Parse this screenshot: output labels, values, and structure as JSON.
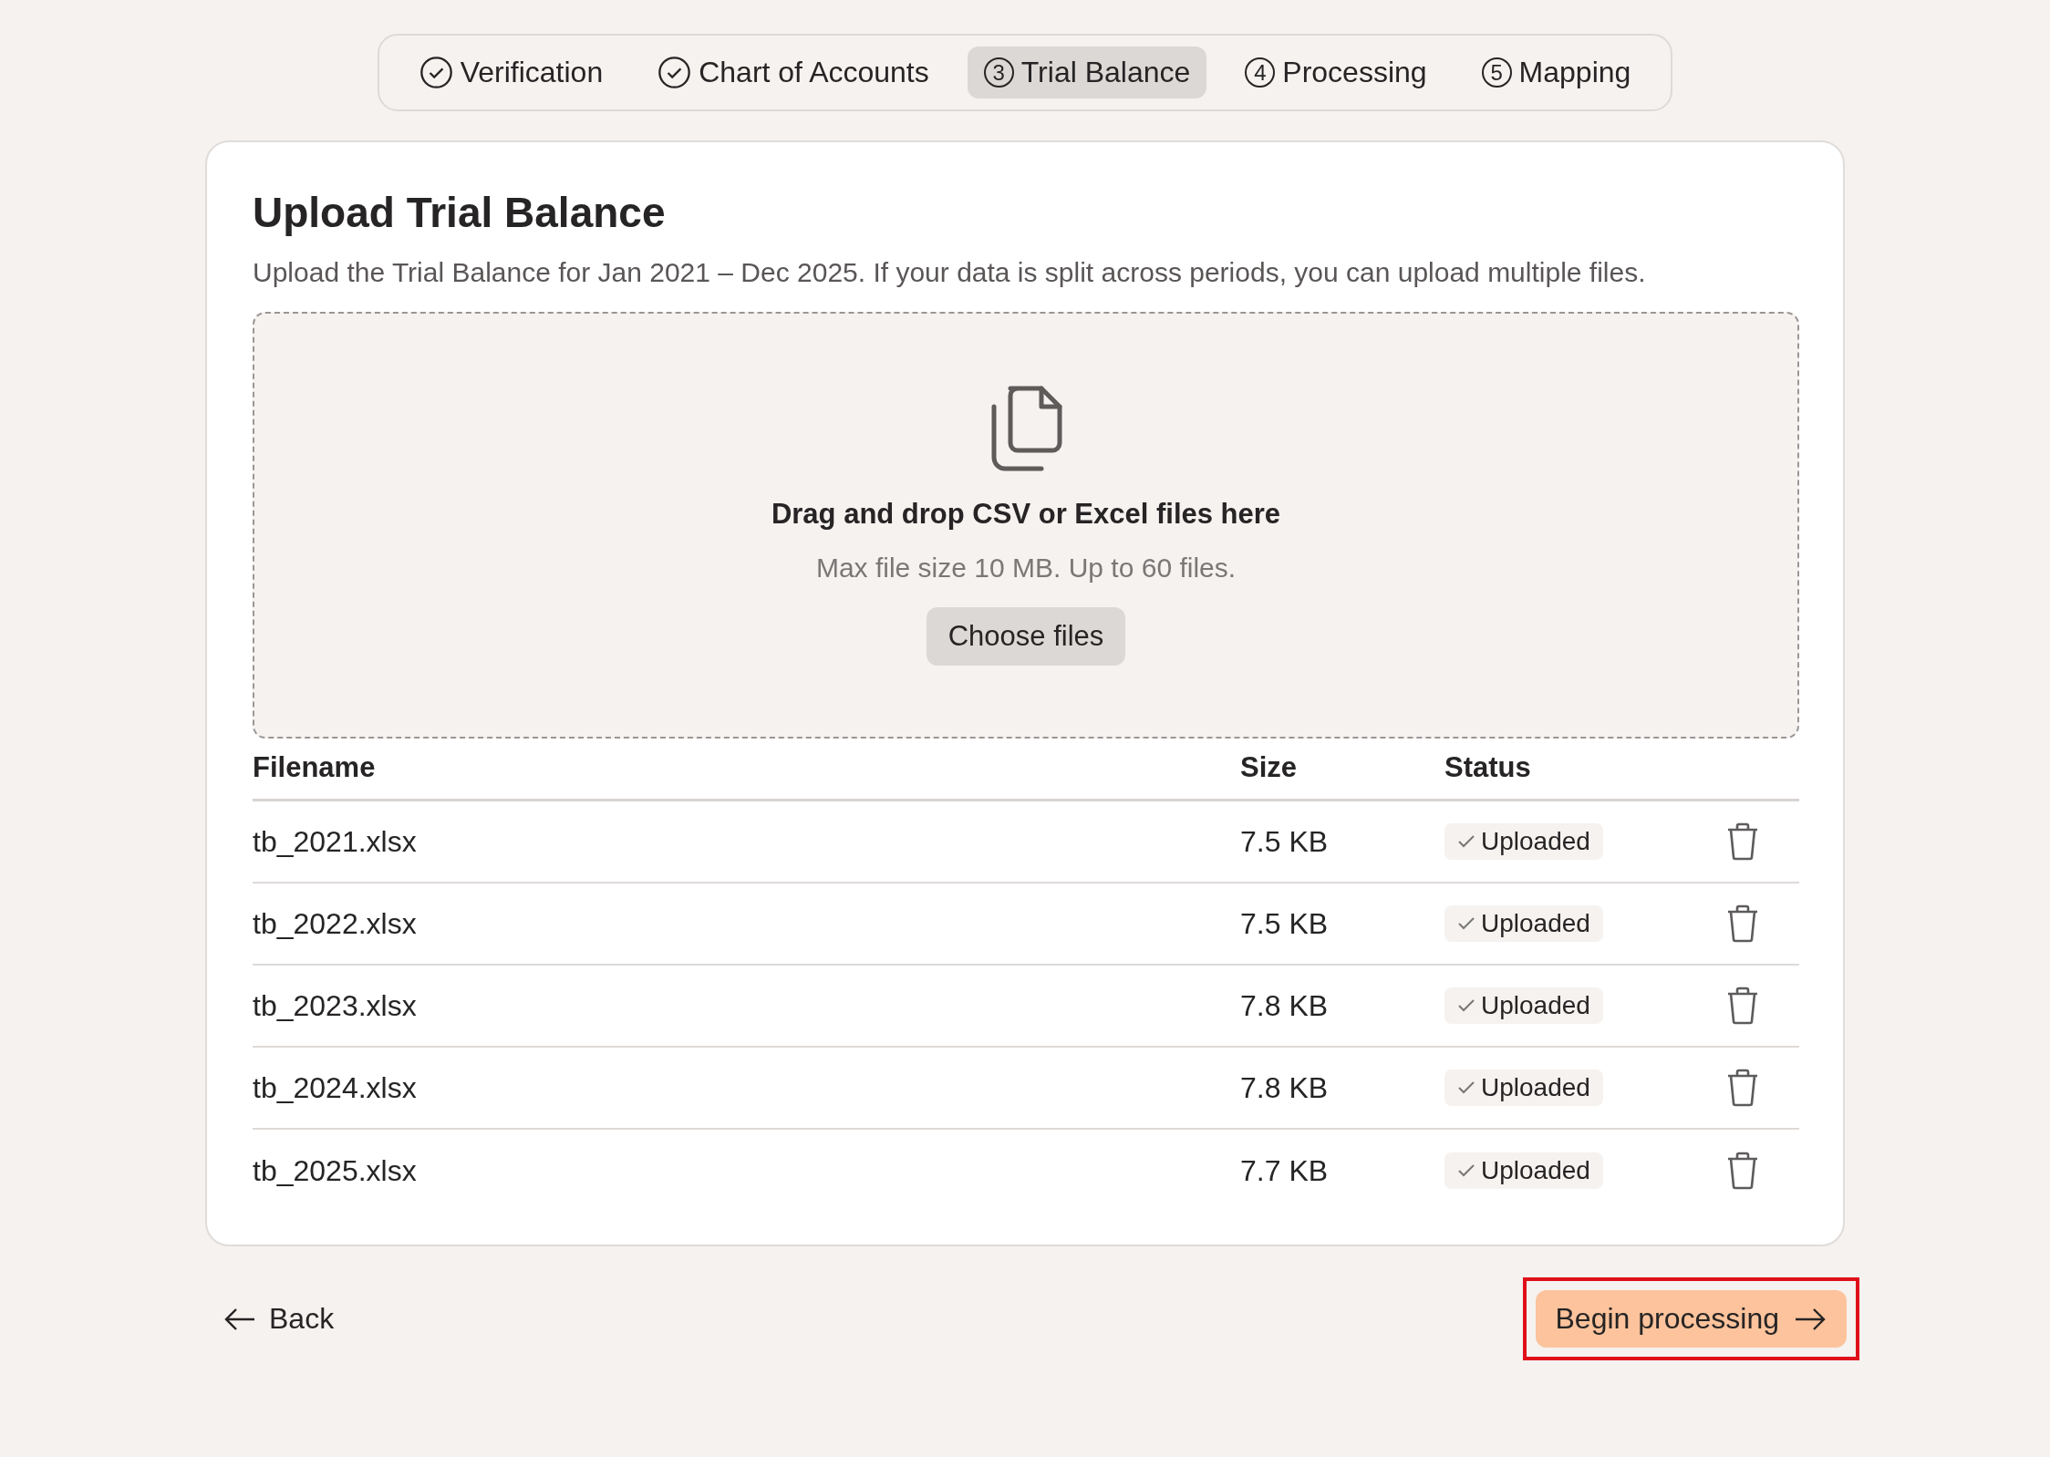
{
  "stepper": [
    {
      "label": "Verification",
      "kind": "done",
      "selected": false
    },
    {
      "label": "Chart of Accounts",
      "kind": "done",
      "selected": false
    },
    {
      "label": "Trial Balance",
      "kind": "numbered",
      "number": "3",
      "selected": true
    },
    {
      "label": "Processing",
      "kind": "numbered",
      "number": "4",
      "selected": false
    },
    {
      "label": "Mapping",
      "kind": "numbered",
      "number": "5",
      "selected": false
    }
  ],
  "card": {
    "title": "Upload Trial Balance",
    "description": "Upload the Trial Balance for Jan 2021 – Dec 2025. If your data is split across periods, you can upload multiple files.",
    "dropzone": {
      "heading": "Drag and drop CSV or Excel files here",
      "hint": "Max file size 10 MB. Up to 60 files.",
      "button": "Choose files"
    },
    "table": {
      "columns": [
        "Filename",
        "Size",
        "Status"
      ],
      "rows": [
        {
          "filename": "tb_2021.xlsx",
          "size": "7.5 KB",
          "status": "Uploaded"
        },
        {
          "filename": "tb_2022.xlsx",
          "size": "7.5 KB",
          "status": "Uploaded"
        },
        {
          "filename": "tb_2023.xlsx",
          "size": "7.8 KB",
          "status": "Uploaded"
        },
        {
          "filename": "tb_2024.xlsx",
          "size": "7.8 KB",
          "status": "Uploaded"
        },
        {
          "filename": "tb_2025.xlsx",
          "size": "7.7 KB",
          "status": "Uploaded"
        }
      ]
    }
  },
  "footer": {
    "back": "Back",
    "next": {
      "label": "Begin processing",
      "highlighted": true
    }
  }
}
